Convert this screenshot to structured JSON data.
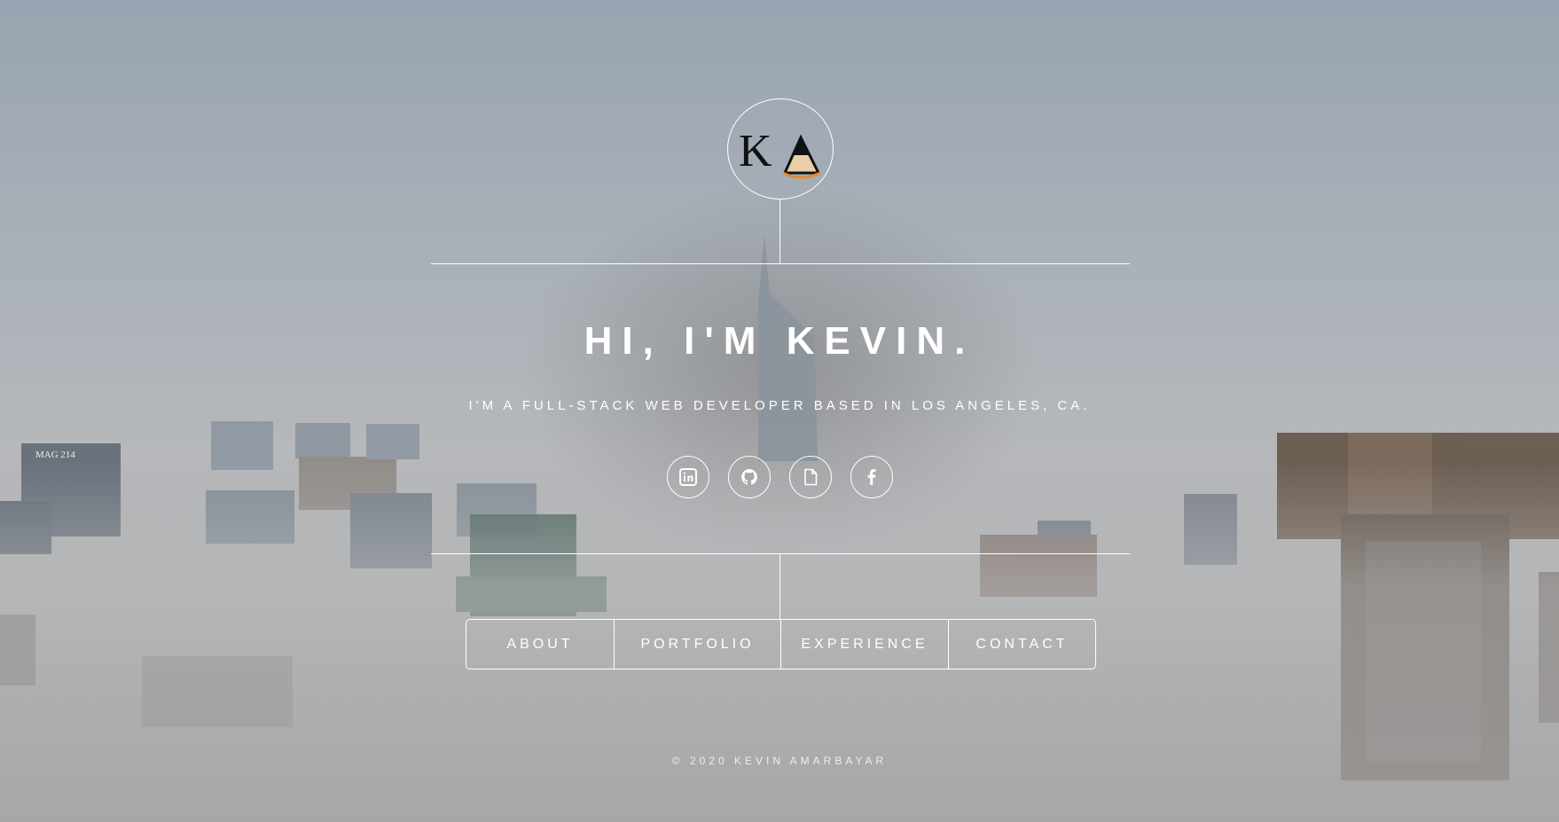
{
  "logo": {
    "initials": "KA",
    "accent": "#e68a2e"
  },
  "hero": {
    "title": "HI, I'M KEVIN.",
    "subtitle": "I'M A FULL-STACK WEB DEVELOPER BASED IN LOS ANGELES, CA."
  },
  "social": [
    {
      "icon": "linkedin-icon"
    },
    {
      "icon": "github-icon"
    },
    {
      "icon": "document-icon"
    },
    {
      "icon": "facebook-icon"
    }
  ],
  "nav": {
    "items": [
      {
        "label": "ABOUT"
      },
      {
        "label": "PORTFOLIO"
      },
      {
        "label": "EXPERIENCE"
      },
      {
        "label": "CONTACT"
      }
    ]
  },
  "footer": {
    "text": "© 2020 KEVIN AMARBAYAR"
  },
  "background": {
    "building_sign": "MAG 214"
  },
  "colors": {
    "line": "#ffffff",
    "text": "#ffffff"
  }
}
